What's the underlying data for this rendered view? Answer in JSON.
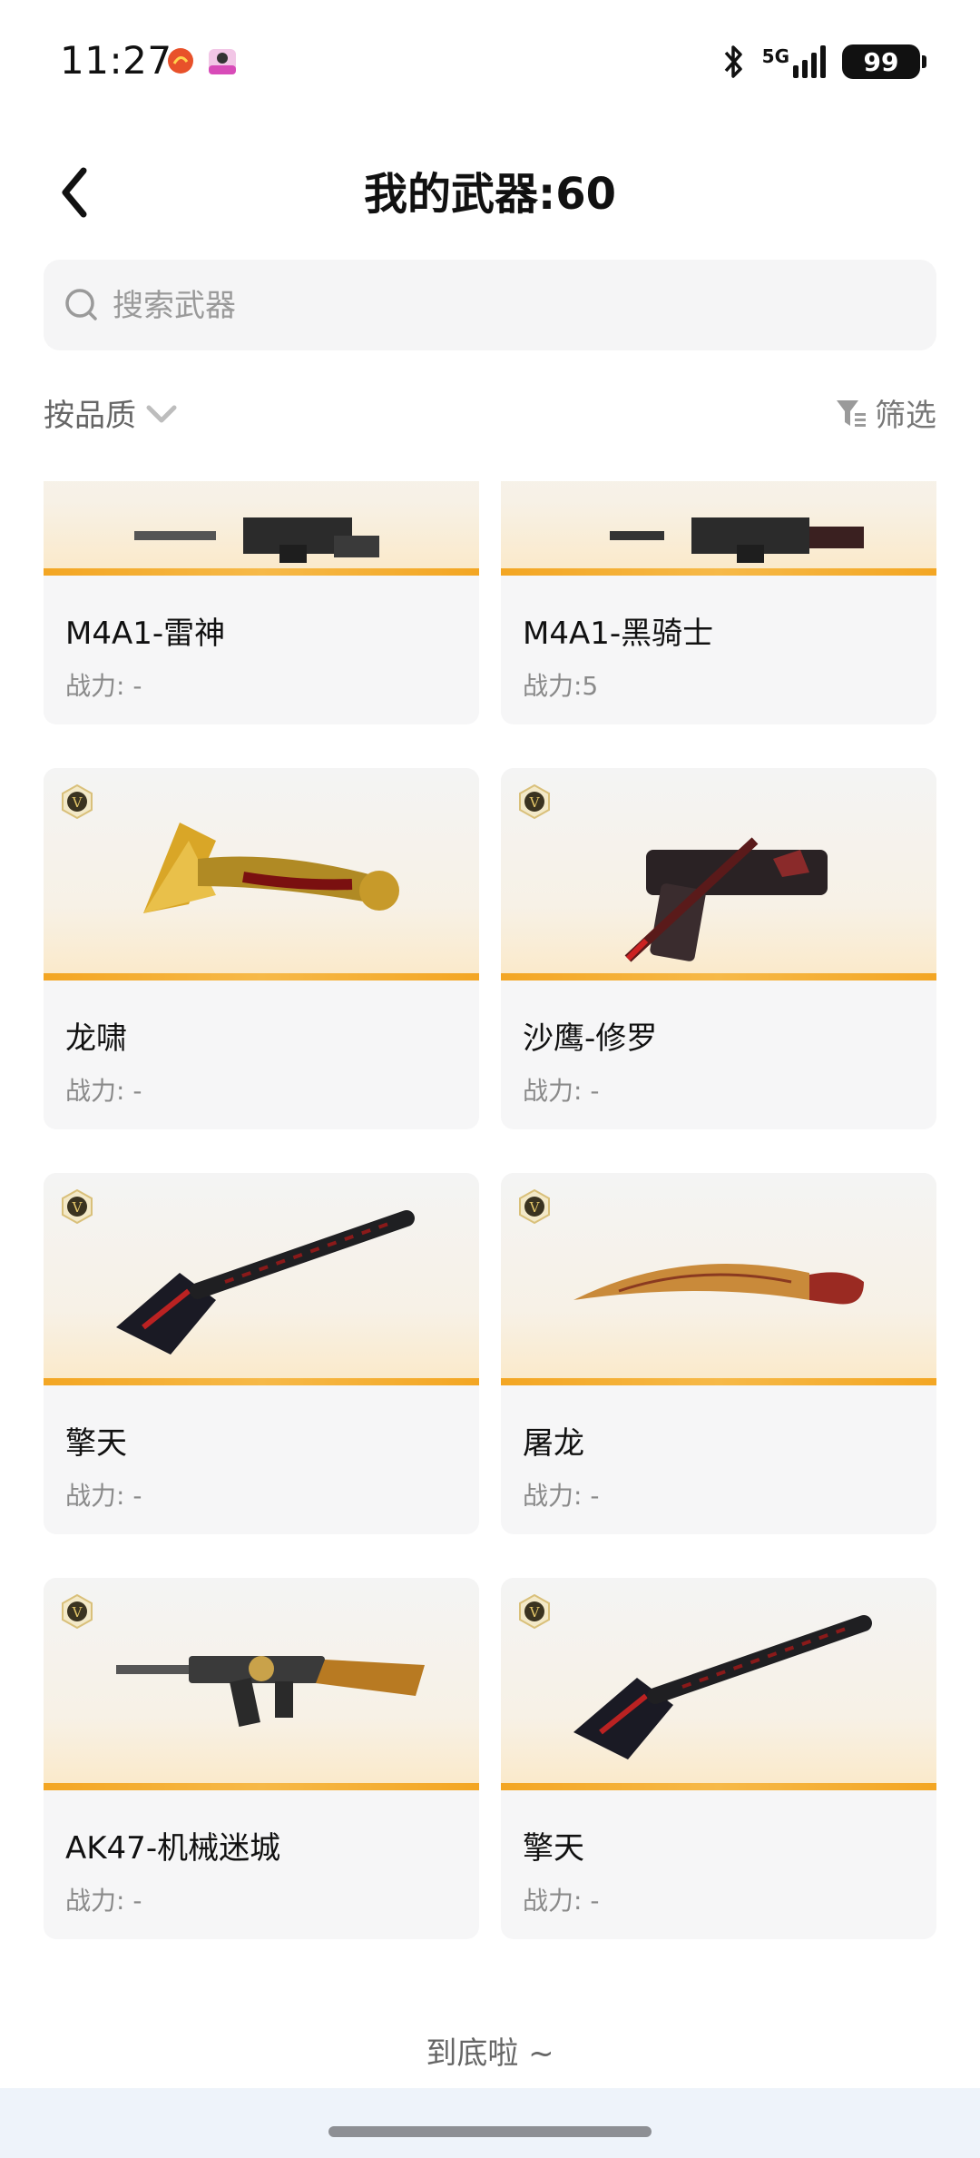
{
  "status_bar": {
    "time": "11:27",
    "network": "5G",
    "battery": "99",
    "app_icons": [
      "weibo-icon",
      "app-icon"
    ]
  },
  "header": {
    "title": "我的武器:60",
    "back_icon": "chevron-left-icon"
  },
  "search": {
    "placeholder": "搜索武器",
    "value": ""
  },
  "filters": {
    "sort_label": "按品质",
    "filter_label": "筛选"
  },
  "weapons": [
    {
      "name": "M4A1-雷神",
      "power": "战力: -",
      "badge": false
    },
    {
      "name": "M4A1-黑骑士",
      "power": "战力:5",
      "badge": false
    },
    {
      "name": "龙啸",
      "power": "战力: -",
      "badge": true
    },
    {
      "name": "沙鹰-修罗",
      "power": "战力: -",
      "badge": true
    },
    {
      "name": "擎天",
      "power": "战力: -",
      "badge": true
    },
    {
      "name": "屠龙",
      "power": "战力: -",
      "badge": true
    },
    {
      "name": "AK47-机械迷城",
      "power": "战力: -",
      "badge": true
    },
    {
      "name": "擎天",
      "power": "战力: -",
      "badge": true
    }
  ],
  "footer": {
    "end_text": "到底啦 ~"
  },
  "colors": {
    "accent_bar": "#f3a623",
    "card_bg": "#f6f6f7",
    "badge_gold": "#b98b2e"
  }
}
